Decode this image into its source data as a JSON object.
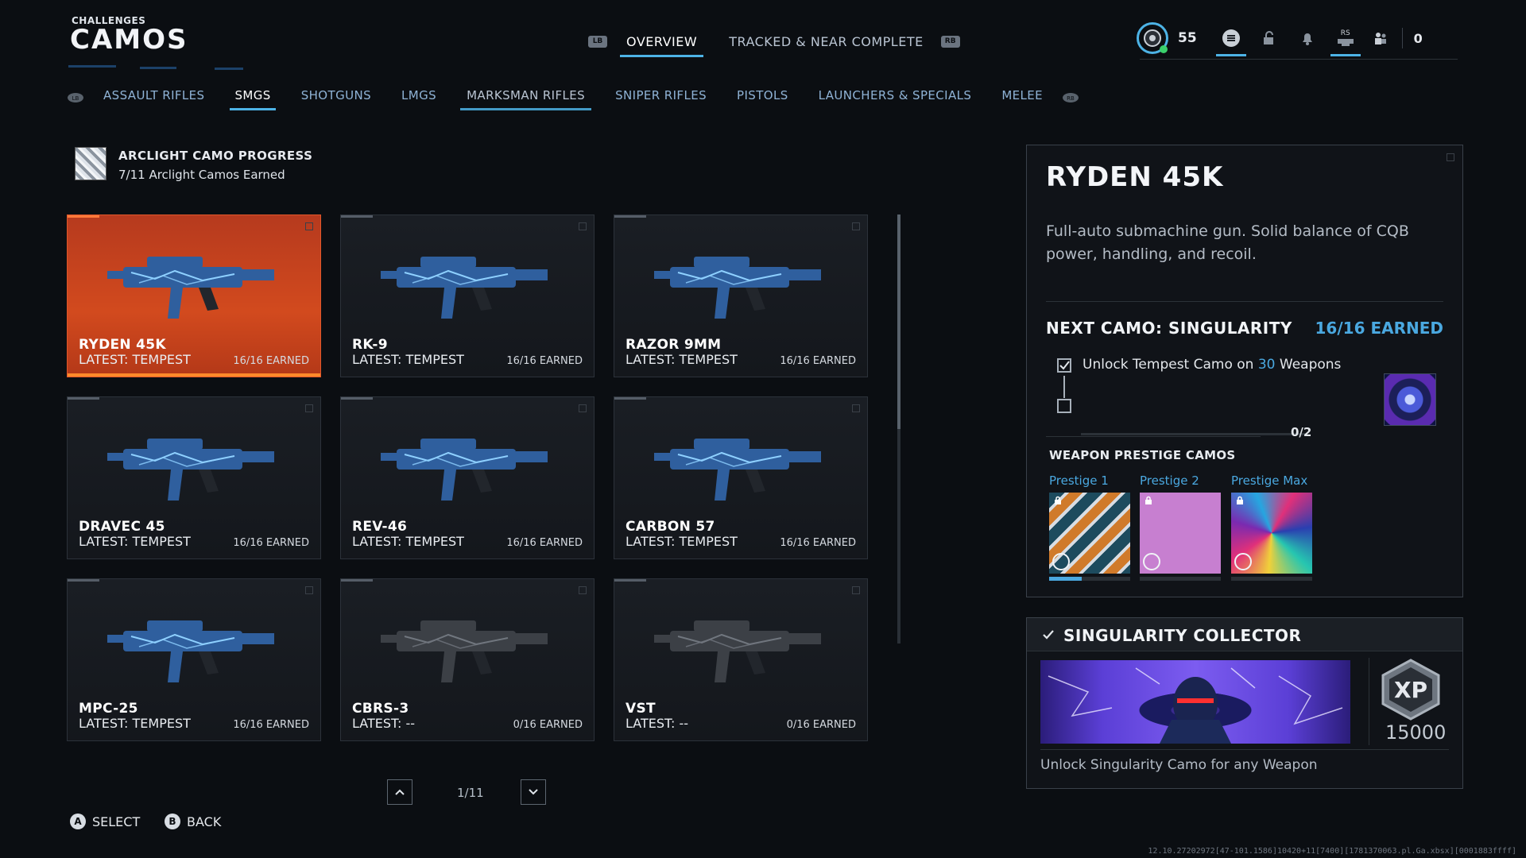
{
  "header": {
    "kicker": "CHALLENGES",
    "title": "CAMOS",
    "lb": "LB",
    "rb": "RB",
    "tabs": [
      {
        "label": "OVERVIEW",
        "active": true
      },
      {
        "label": "TRACKED & NEAR COMPLETE",
        "active": false
      }
    ]
  },
  "hud": {
    "level": "55",
    "rs": "RS",
    "count": "0"
  },
  "subnav": {
    "items": [
      "ASSAULT RIFLES",
      "SMGS",
      "SHOTGUNS",
      "LMGS",
      "MARKSMAN RIFLES",
      "SNIPER RIFLES",
      "PISTOLS",
      "LAUNCHERS & SPECIALS",
      "MELEE"
    ]
  },
  "progress": {
    "title": "ARCLIGHT CAMO PROGRESS",
    "subtitle": "7/11 Arclight Camos Earned"
  },
  "weapons": [
    {
      "name": "RYDEN 45K",
      "latest": "LATEST: TEMPEST",
      "earned": "16/16 EARNED"
    },
    {
      "name": "RK-9",
      "latest": "LATEST: TEMPEST",
      "earned": "16/16 EARNED"
    },
    {
      "name": "RAZOR 9MM",
      "latest": "LATEST: TEMPEST",
      "earned": "16/16 EARNED"
    },
    {
      "name": "DRAVEC 45",
      "latest": "LATEST: TEMPEST",
      "earned": "16/16 EARNED"
    },
    {
      "name": "REV-46",
      "latest": "LATEST: TEMPEST",
      "earned": "16/16 EARNED"
    },
    {
      "name": "CARBON 57",
      "latest": "LATEST: TEMPEST",
      "earned": "16/16 EARNED"
    },
    {
      "name": "MPC-25",
      "latest": "LATEST: TEMPEST",
      "earned": "16/16 EARNED"
    },
    {
      "name": "CBRS-3",
      "latest": "LATEST: --",
      "earned": "0/16 EARNED"
    },
    {
      "name": "VST",
      "latest": "LATEST: --",
      "earned": "0/16 EARNED"
    }
  ],
  "pager": {
    "text": "1/11"
  },
  "hints": {
    "a_key": "A",
    "a_label": "SELECT",
    "b_key": "B",
    "b_label": "BACK"
  },
  "detail": {
    "title": "RYDEN 45K",
    "description": "Full-auto submachine gun. Solid balance of CQB power, handling, and recoil.",
    "next_camo_label": "NEXT CAMO: SINGULARITY",
    "next_camo_earned": "16/16 EARNED",
    "req_pre": "Unlock Tempest Camo on ",
    "req_num": "30",
    "req_post": " Weapons",
    "req_progress": "0/2",
    "prestige_heading": "WEAPON PRESTIGE CAMOS",
    "prestige": [
      "Prestige 1",
      "Prestige 2",
      "Prestige Max"
    ]
  },
  "reward": {
    "title": "SINGULARITY COLLECTOR",
    "xp_badge": "XP",
    "xp": "15000",
    "description": "Unlock Singularity Camo for any Weapon"
  },
  "build": "12.10.27202972[47-101.1586]10420+11[7400][1781370063.pl.Ga.xbsx][0001883ffff]",
  "colors": {
    "accent": "#4db3e6",
    "selected_card": "#d24a1e",
    "highlight": "#4aa8e0"
  }
}
